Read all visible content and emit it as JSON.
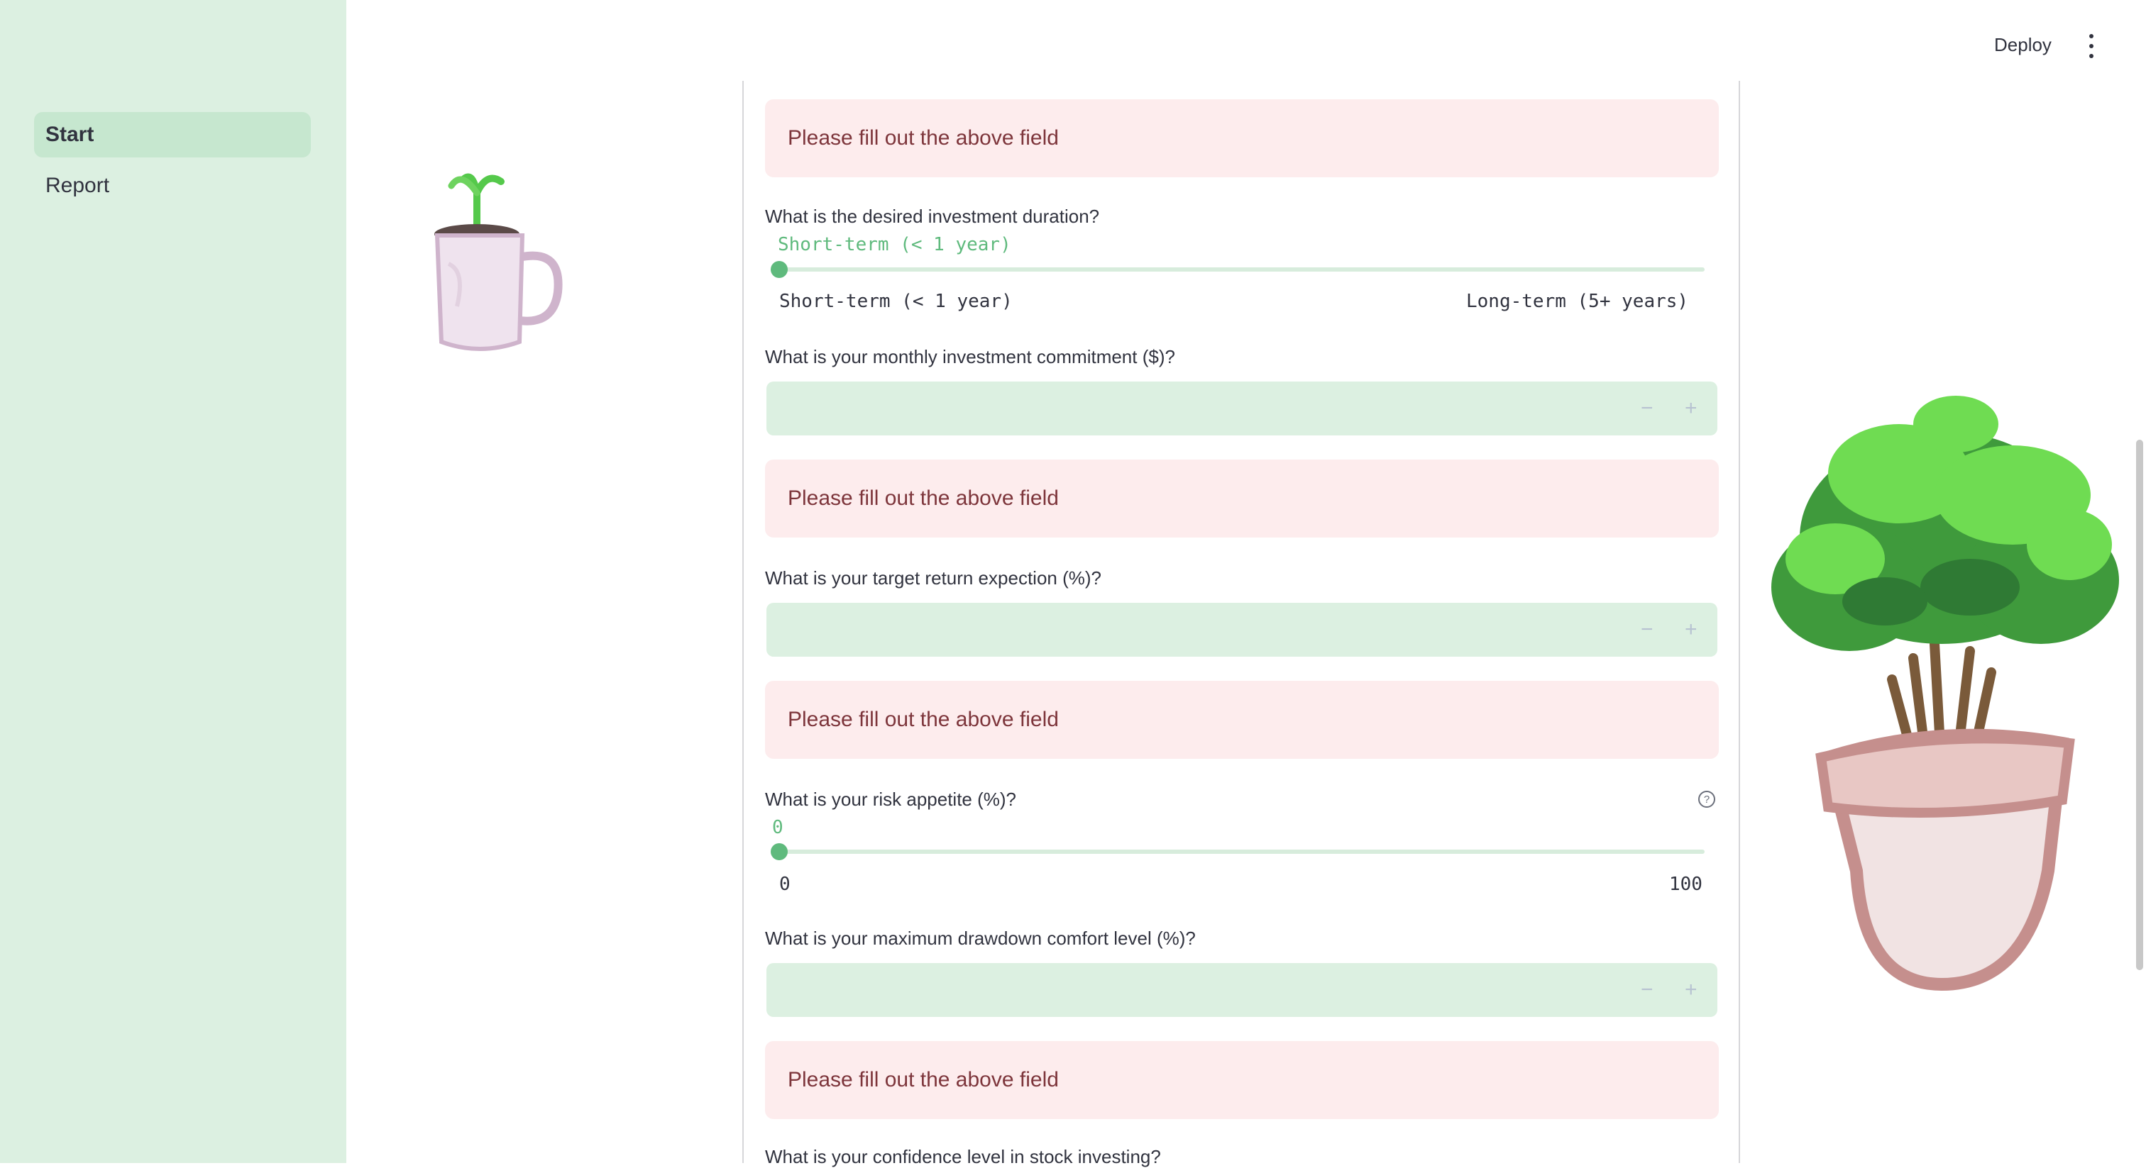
{
  "sidebar": {
    "items": [
      {
        "label": "Start",
        "active": true
      },
      {
        "label": "Report",
        "active": false
      }
    ]
  },
  "header": {
    "deploy_label": "Deploy",
    "menu_icon": "kebab-menu-icon"
  },
  "form": {
    "alert_text": "Please fill out the above field",
    "duration": {
      "question": "What is the desired investment duration?",
      "value": "Short-term (< 1 year)",
      "min_label": "Short-term (< 1 year)",
      "max_label": "Long-term (5+ years)"
    },
    "monthly": {
      "question": "What is your monthly investment commitment ($)?",
      "value": ""
    },
    "target_return": {
      "question": "What is your target return expection (%)?",
      "value": ""
    },
    "risk": {
      "question": "What is your risk appetite (%)?",
      "value": "0",
      "min_label": "0",
      "max_label": "100"
    },
    "drawdown": {
      "question": "What is your maximum drawdown comfort level (%)?",
      "value": ""
    },
    "confidence": {
      "question": "What is your confidence level in stock investing?"
    },
    "stepper_minus": "−",
    "stepper_plus": "+"
  },
  "colors": {
    "sidebar_bg": "#dcf0e1",
    "accent": "#5fba7d",
    "alert_bg": "#fdeced",
    "alert_text": "#7d353b"
  }
}
